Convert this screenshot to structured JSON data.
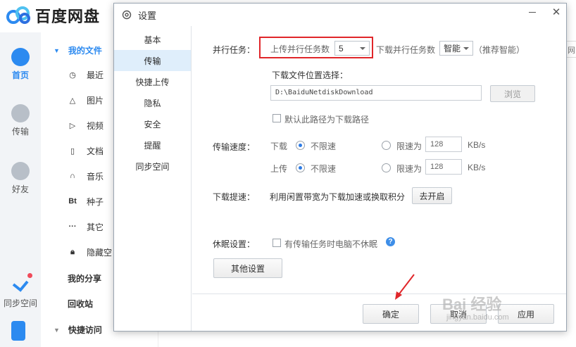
{
  "app": {
    "brand": "百度网盘",
    "leftnav": [
      {
        "label": "首页",
        "icon": "cloud-icon",
        "active": true
      },
      {
        "label": "传输",
        "icon": "transfer-icon"
      },
      {
        "label": "好友",
        "icon": "friends-icon"
      },
      {
        "label": "同步空间",
        "icon": "sync-icon"
      }
    ],
    "subnav": {
      "my_files": "我的文件",
      "items": [
        {
          "label": "最近",
          "icon": "clock-icon"
        },
        {
          "label": "图片",
          "icon": "image-icon"
        },
        {
          "label": "视频",
          "icon": "play-icon"
        },
        {
          "label": "文档",
          "icon": "document-icon"
        },
        {
          "label": "音乐",
          "icon": "headphones-icon"
        },
        {
          "label": "种子",
          "icon": "bt-icon",
          "glyph": "Bt"
        },
        {
          "label": "其它",
          "icon": "more-icon",
          "glyph": "···"
        },
        {
          "label": "隐藏空",
          "icon": "lock-icon"
        }
      ],
      "my_share": "我的分享",
      "recycle": "回收站",
      "quick_access": "快捷访问"
    },
    "right_peek": "网"
  },
  "dialog": {
    "title": "设置",
    "tabs": [
      "基本",
      "传输",
      "快捷上传",
      "隐私",
      "安全",
      "提醒",
      "同步空间"
    ],
    "active_tab": "传输",
    "parallel": {
      "label": "并行任务：",
      "upload_label": "上传并行任务数",
      "upload_value": "5",
      "download_label": "下载并行任务数",
      "download_value": "智能",
      "recommend": "（推荐智能）"
    },
    "download_location": {
      "label": "下载文件位置选择：",
      "path": "D:\\BaiduNetdiskDownload",
      "browse": "浏览",
      "default_checkbox": "默认此路径为下载路径"
    },
    "speed": {
      "label": "传输速度：",
      "download": "下载",
      "upload": "上传",
      "unlimited": "不限速",
      "limit_to": "限速为",
      "download_limit": "128",
      "upload_limit": "128",
      "unit": "KB/s"
    },
    "accelerate": {
      "label": "下载提速：",
      "text": "利用闲置带宽为下载加速或换取积分",
      "button": "去开启"
    },
    "sleep": {
      "label": "休眠设置：",
      "checkbox": "有传输任务时电脑不休眠"
    },
    "other_button": "其他设置",
    "footer": {
      "ok": "确定",
      "cancel": "取消",
      "apply": "应用"
    }
  },
  "watermark": {
    "main": "Bai 经验",
    "sub": "jingyan.baidu.com"
  },
  "colors": {
    "accent": "#2c8af0",
    "highlight": "#e0262a",
    "active_tab_bg": "#dfeefb"
  }
}
